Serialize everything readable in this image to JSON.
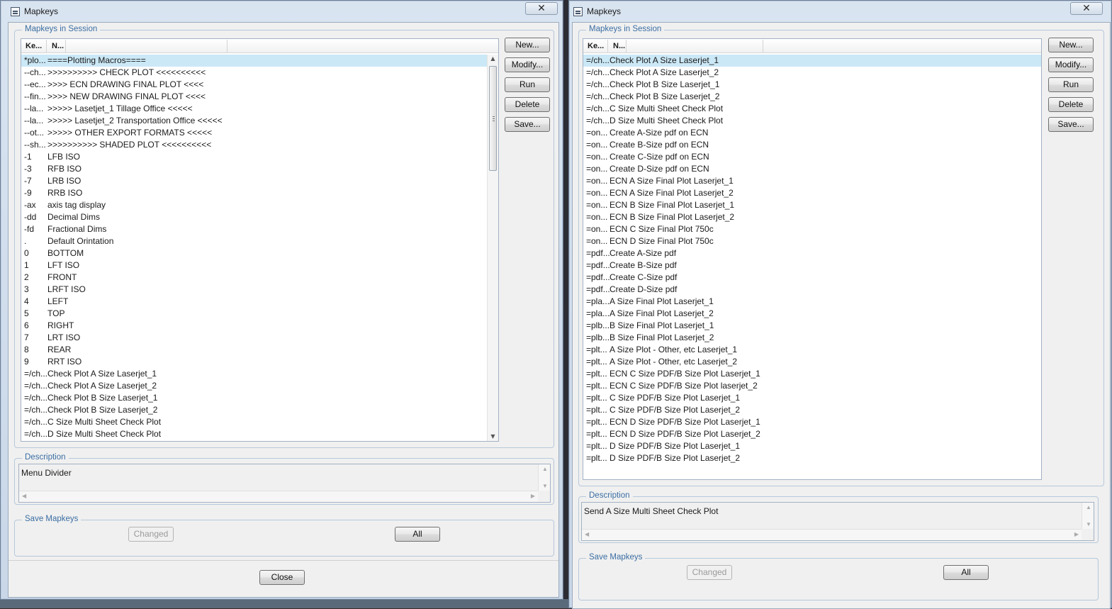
{
  "left_window": {
    "title": "Mapkeys",
    "close_glyph": "✕",
    "group_label": "Mapkeys in Session",
    "columns": [
      "Ke...",
      "N..."
    ],
    "selected_index": 0,
    "rows": [
      {
        "key": "*plo...",
        "name": "====Plotting Macros===="
      },
      {
        "key": "--ch...",
        "name": ">>>>>>>>>> CHECK PLOT <<<<<<<<<<"
      },
      {
        "key": "--ec...",
        "name": ">>>> ECN DRAWING FINAL PLOT <<<<"
      },
      {
        "key": "--fin...",
        "name": ">>>> NEW DRAWING FINAL PLOT <<<<"
      },
      {
        "key": "--la...",
        "name": ">>>>> Lasetjet_1 Tillage Office <<<<<"
      },
      {
        "key": "--la...",
        "name": ">>>>> Lasetjet_2 Transportation Office <<<<<"
      },
      {
        "key": "--ot...",
        "name": ">>>>> OTHER EXPORT FORMATS <<<<<"
      },
      {
        "key": "--sh...",
        "name": ">>>>>>>>>> SHADED PLOT <<<<<<<<<<"
      },
      {
        "key": "-1",
        "name": "LFB ISO"
      },
      {
        "key": "-3",
        "name": "RFB ISO"
      },
      {
        "key": "-7",
        "name": "LRB ISO"
      },
      {
        "key": "-9",
        "name": "RRB ISO"
      },
      {
        "key": "-ax",
        "name": "axis tag display"
      },
      {
        "key": "-dd",
        "name": "Decimal Dims"
      },
      {
        "key": "-fd",
        "name": "Fractional Dims"
      },
      {
        "key": ".",
        "name": "Default Orintation"
      },
      {
        "key": "0",
        "name": "BOTTOM"
      },
      {
        "key": "1",
        "name": "LFT ISO"
      },
      {
        "key": "2",
        "name": "FRONT"
      },
      {
        "key": "3",
        "name": "LRFT ISO"
      },
      {
        "key": "4",
        "name": "LEFT"
      },
      {
        "key": "5",
        "name": "TOP"
      },
      {
        "key": "6",
        "name": "RIGHT"
      },
      {
        "key": "7",
        "name": "LRT ISO"
      },
      {
        "key": "8",
        "name": "REAR"
      },
      {
        "key": "9",
        "name": "RRT ISO"
      },
      {
        "key": "=/ch...",
        "name": "Check Plot A Size Laserjet_1"
      },
      {
        "key": "=/ch...",
        "name": "Check Plot A Size Laserjet_2"
      },
      {
        "key": "=/ch...",
        "name": "Check Plot B Size Laserjet_1"
      },
      {
        "key": "=/ch...",
        "name": "Check Plot B Size Laserjet_2"
      },
      {
        "key": "=/ch...",
        "name": "C Size Multi Sheet Check Plot"
      },
      {
        "key": "=/ch...",
        "name": "D Size Multi Sheet Check Plot"
      }
    ],
    "buttons": {
      "new": "New...",
      "modify": "Modify...",
      "run": "Run",
      "delete": "Delete",
      "save": "Save..."
    },
    "description_label": "Description",
    "description_text": "Menu Divider",
    "save_label": "Save Mapkeys",
    "changed_label": "Changed",
    "all_label": "All",
    "close_label": "Close"
  },
  "right_window": {
    "title": "Mapkeys",
    "close_glyph": "✕",
    "group_label": "Mapkeys in Session",
    "columns": [
      "Ke...",
      "N..."
    ],
    "selected_index": 0,
    "rows": [
      {
        "key": "=/ch...",
        "name": "Check Plot A Size Laserjet_1"
      },
      {
        "key": "=/ch...",
        "name": "Check Plot A Size Laserjet_2"
      },
      {
        "key": "=/ch...",
        "name": "Check Plot B Size Laserjet_1"
      },
      {
        "key": "=/ch...",
        "name": "Check Plot B Size Laserjet_2"
      },
      {
        "key": "=/ch...",
        "name": "C Size Multi Sheet Check Plot"
      },
      {
        "key": "=/ch...",
        "name": "D Size Multi Sheet Check Plot"
      },
      {
        "key": "=on...",
        "name": "Create A-Size pdf on ECN"
      },
      {
        "key": "=on...",
        "name": "Create B-Size pdf on ECN"
      },
      {
        "key": "=on...",
        "name": "Create C-Size pdf on ECN"
      },
      {
        "key": "=on...",
        "name": "Create D-Size pdf on ECN"
      },
      {
        "key": "=on...",
        "name": "ECN A Size Final Plot Laserjet_1"
      },
      {
        "key": "=on...",
        "name": "ECN A Size Final Plot Laserjet_2"
      },
      {
        "key": "=on...",
        "name": "ECN B Size Final Plot Laserjet_1"
      },
      {
        "key": "=on...",
        "name": "ECN B Size Final Plot Laserjet_2"
      },
      {
        "key": "=on...",
        "name": "ECN C Size Final Plot 750c"
      },
      {
        "key": "=on...",
        "name": "ECN D Size Final Plot 750c"
      },
      {
        "key": "=pdf...",
        "name": "Create A-Size pdf"
      },
      {
        "key": "=pdf...",
        "name": "Create B-Size pdf"
      },
      {
        "key": "=pdf...",
        "name": "Create C-Size pdf"
      },
      {
        "key": "=pdf...",
        "name": "Create D-Size pdf"
      },
      {
        "key": "=pla...",
        "name": "A Size Final Plot Laserjet_1"
      },
      {
        "key": "=pla...",
        "name": "A Size Final Plot Laserjet_2"
      },
      {
        "key": "=plb...",
        "name": "B Size Final Plot Laserjet_1"
      },
      {
        "key": "=plb...",
        "name": "B Size Final Plot Laserjet_2"
      },
      {
        "key": "=plt...",
        "name": "A Size Plot - Other, etc Laserjet_1"
      },
      {
        "key": "=plt...",
        "name": "A Size Plot - Other, etc Laserjet_2"
      },
      {
        "key": "=plt...",
        "name": "ECN C Size PDF/B Size Plot Laserjet_1"
      },
      {
        "key": "=plt...",
        "name": "ECN C Size PDF/B Size Plot laserjet_2"
      },
      {
        "key": "=plt...",
        "name": "C Size PDF/B Size Plot Laserjet_1"
      },
      {
        "key": "=plt...",
        "name": "C Size PDF/B Size Plot Laserjet_2"
      },
      {
        "key": "=plt...",
        "name": "ECN D Size PDF/B Size Plot Laserjet_1"
      },
      {
        "key": "=plt...",
        "name": "ECN D Size PDF/B Size Plot Laserjet_2"
      },
      {
        "key": "=plt...",
        "name": "D Size PDF/B Size Plot Laserjet_1"
      },
      {
        "key": "=plt...",
        "name": "D Size PDF/B Size Plot Laserjet_2"
      }
    ],
    "buttons": {
      "new": "New...",
      "modify": "Modify...",
      "run": "Run",
      "delete": "Delete",
      "save": "Save..."
    },
    "description_label": "Description",
    "description_text": "Send A Size Multi Sheet Check Plot",
    "save_label": "Save Mapkeys",
    "changed_label": "Changed",
    "all_label": "All"
  }
}
